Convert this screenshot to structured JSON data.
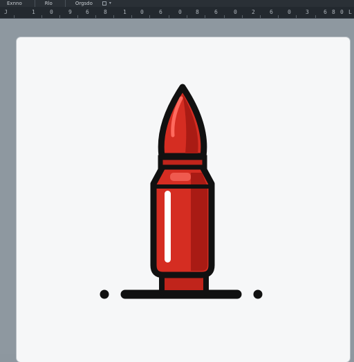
{
  "menubar": {
    "items": [
      "Exnno",
      "Rlo",
      "Orgsdo"
    ],
    "tools": [
      "document-icon",
      "chevron-down-icon"
    ]
  },
  "ruler": {
    "labels": [
      "J",
      "1",
      "0",
      "9",
      "6",
      "8",
      "1",
      "0",
      "6",
      "0",
      "8",
      "6",
      "0",
      "2",
      "6",
      "0",
      "3",
      "6",
      "8",
      "0",
      "L"
    ]
  },
  "canvas": {
    "background": "#f6f7f8"
  },
  "illustration": {
    "subject": "red bullet icon",
    "colors": {
      "outline": "#111111",
      "body": "#d52d22",
      "shade": "#a91b14",
      "highlight": "#ffffff",
      "ground": "#111111"
    }
  }
}
